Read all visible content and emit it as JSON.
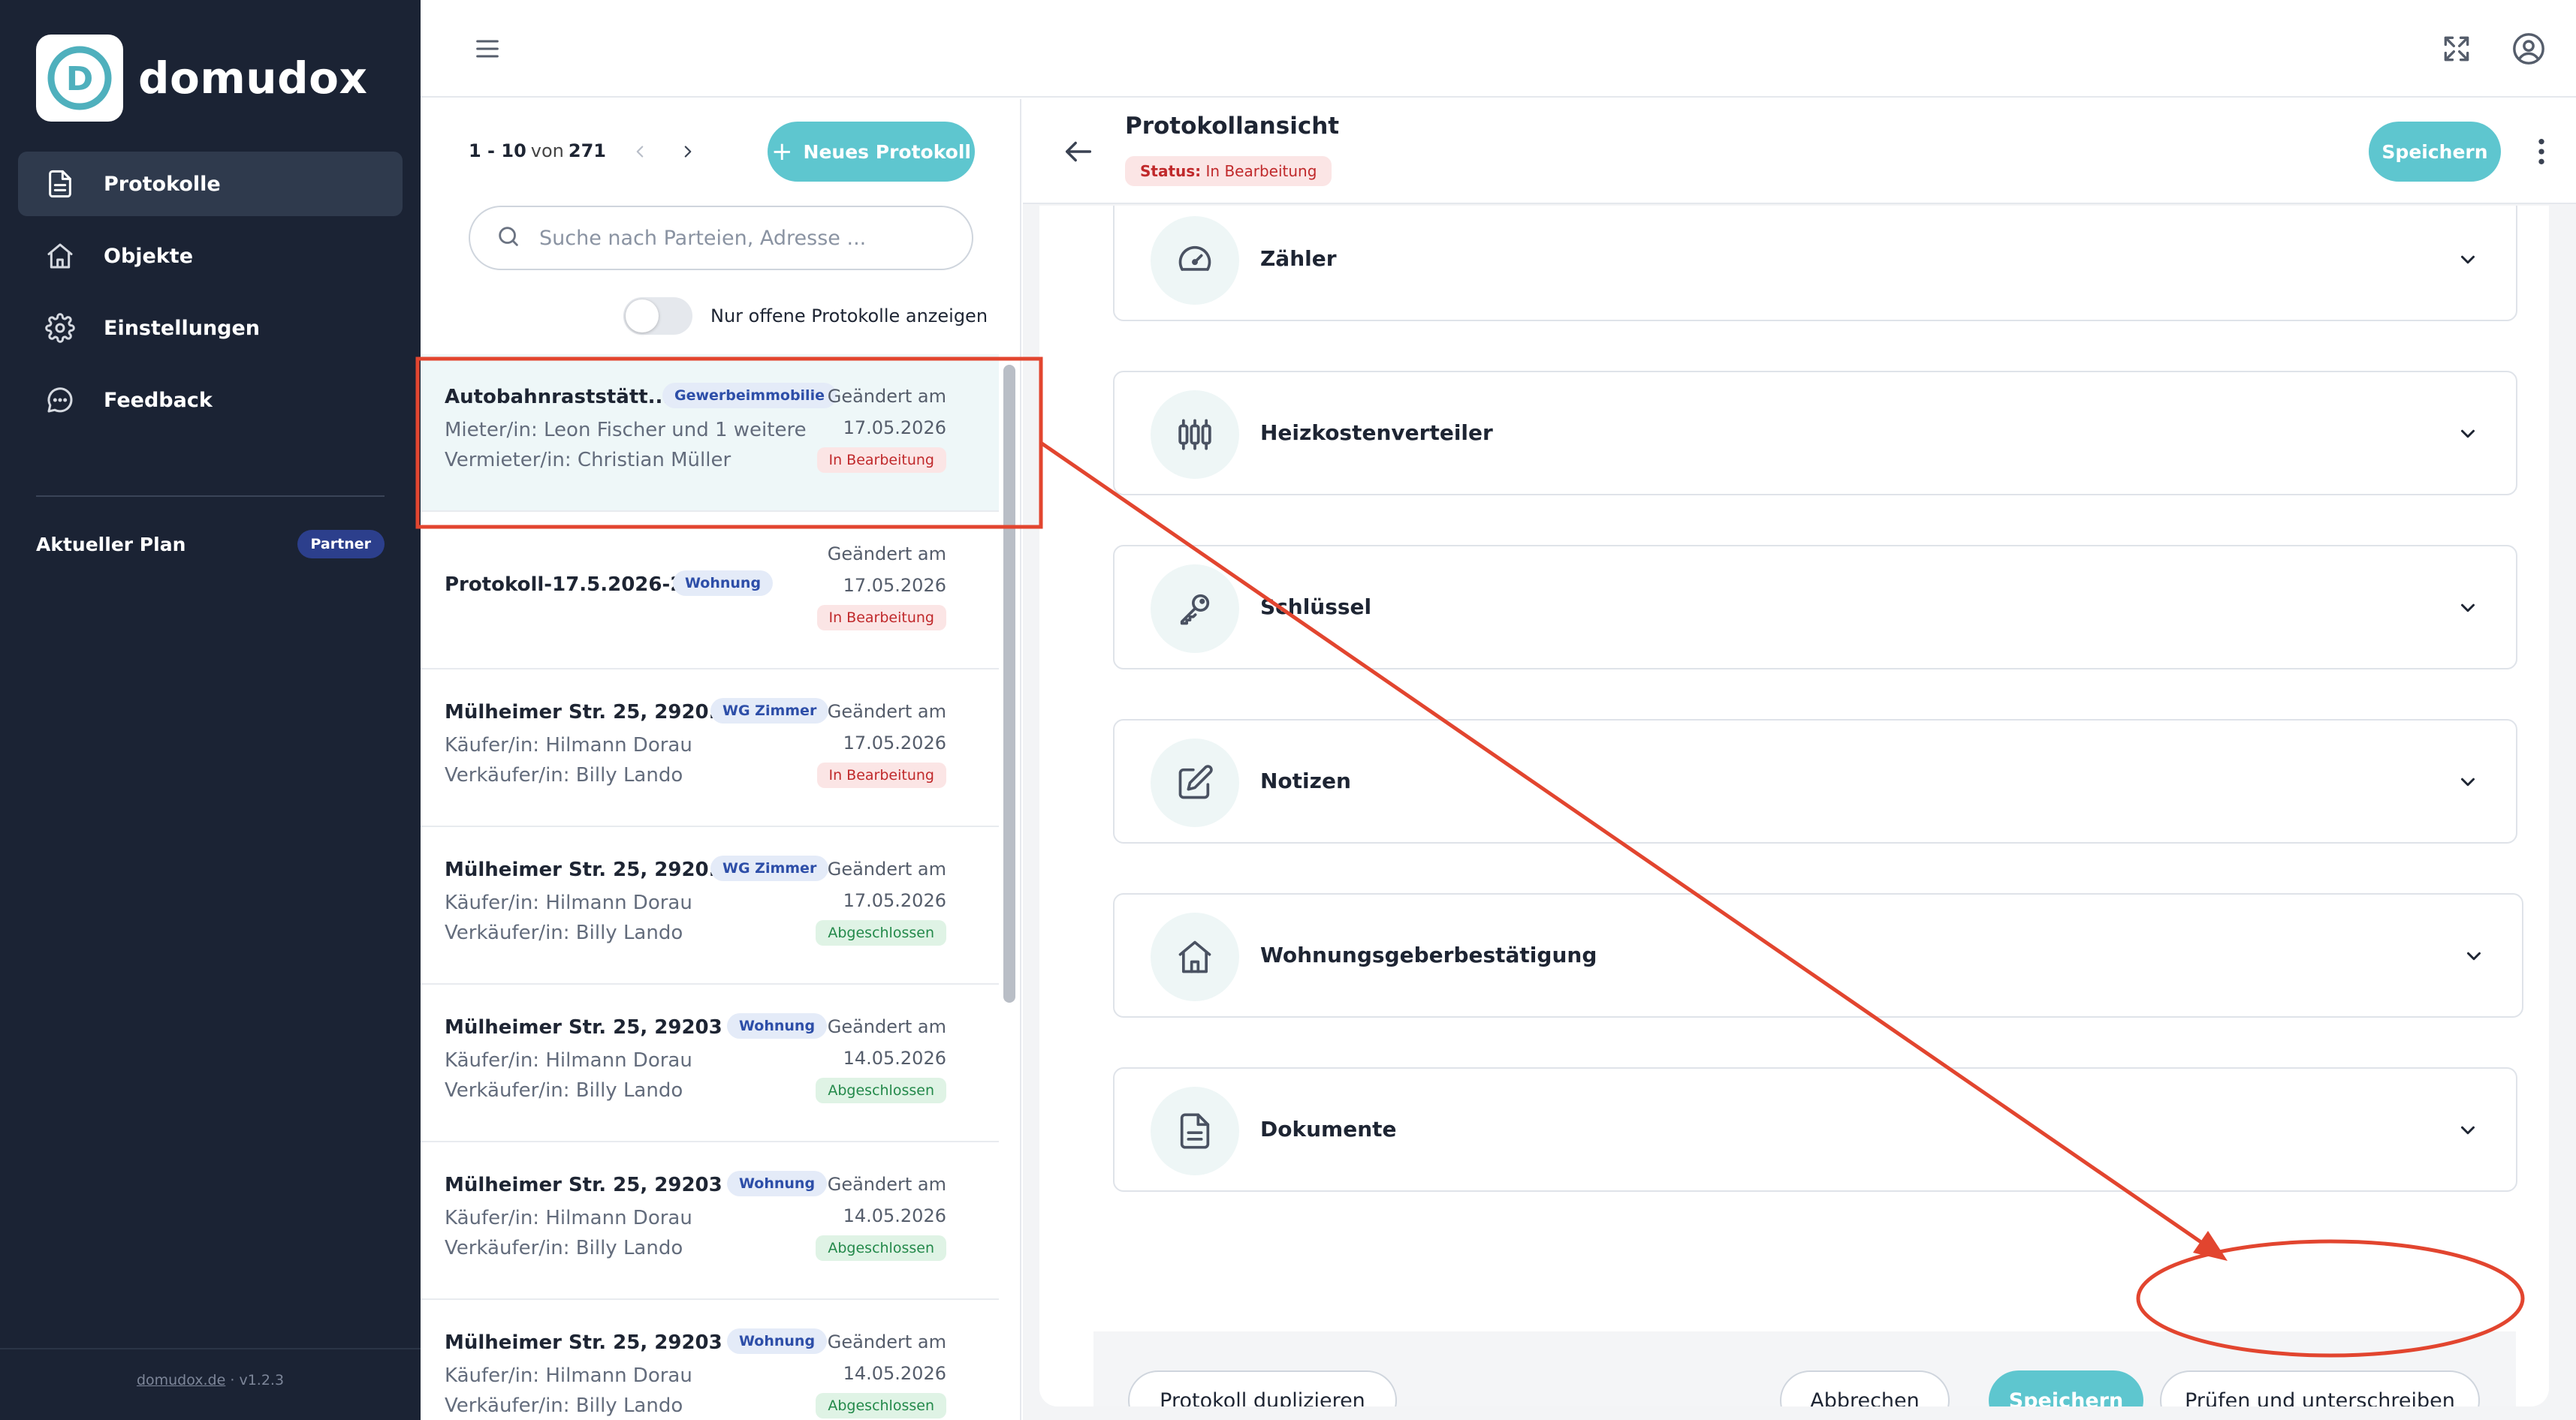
{
  "app": {
    "name": "domudox",
    "logo_letter": "D"
  },
  "sidebar": {
    "items": [
      {
        "label": "Protokolle",
        "icon": "document-icon",
        "active": true
      },
      {
        "label": "Objekte",
        "icon": "home-icon",
        "active": false
      },
      {
        "label": "Einstellungen",
        "icon": "gear-icon",
        "active": false
      },
      {
        "label": "Feedback",
        "icon": "chat-icon",
        "active": false
      }
    ],
    "plan_label": "Aktueller Plan",
    "plan_badge": "Partner",
    "footer_link": "domudox.de",
    "footer_sep": "·",
    "footer_version": "v1.2.3"
  },
  "list": {
    "pager": {
      "range": "1 - 10",
      "of": "von",
      "total": "271"
    },
    "new_button": "Neues Protokoll",
    "search_placeholder": "Suche nach Parteien, Adresse ...",
    "toggle_label": "Nur offene Protokolle anzeigen",
    "items": [
      {
        "title": "Autobahnraststätt...",
        "type": "Gewerbeimmobilie",
        "line1": "Mieter/in: Leon Fischer und 1 weitere",
        "line2": "Vermieter/in: Christian Müller",
        "changed": "Geändert am",
        "date": "17.05.2026",
        "status": "In Bearbeitung"
      },
      {
        "title": "Protokoll-17.5.2026-2",
        "type": "Wohnung",
        "line1": "",
        "line2": "",
        "changed": "Geändert am",
        "date": "17.05.2026",
        "status": "In Bearbeitung"
      },
      {
        "title": "Mülheimer Str. 25, 2920...",
        "type": "WG Zimmer",
        "line1": "Käufer/in: Hilmann Dorau",
        "line2": "Verkäufer/in: Billy Lando",
        "changed": "Geändert am",
        "date": "17.05.2026",
        "status": "In Bearbeitung"
      },
      {
        "title": "Mülheimer Str. 25, 2920...",
        "type": "WG Zimmer",
        "line1": "Käufer/in: Hilmann Dorau",
        "line2": "Verkäufer/in: Billy Lando",
        "changed": "Geändert am",
        "date": "17.05.2026",
        "status": "Abgeschlossen"
      },
      {
        "title": "Mülheimer Str. 25, 29203 ...",
        "type": "Wohnung",
        "line1": "Käufer/in: Hilmann Dorau",
        "line2": "Verkäufer/in: Billy Lando",
        "changed": "Geändert am",
        "date": "14.05.2026",
        "status": "Abgeschlossen"
      },
      {
        "title": "Mülheimer Str. 25, 29203 ...",
        "type": "Wohnung",
        "line1": "Käufer/in: Hilmann Dorau",
        "line2": "Verkäufer/in: Billy Lando",
        "changed": "Geändert am",
        "date": "14.05.2026",
        "status": "Abgeschlossen"
      },
      {
        "title": "Mülheimer Str. 25, 29203 ...",
        "type": "Wohnung",
        "line1": "Käufer/in: Hilmann Dorau",
        "line2": "Verkäufer/in: Billy Lando",
        "changed": "Geändert am",
        "date": "14.05.2026",
        "status": "Abgeschlossen"
      }
    ]
  },
  "detail": {
    "title": "Protokollansicht",
    "status_label": "Status:",
    "status_value": "In Bearbeitung",
    "save_top": "Speichern",
    "sections": [
      {
        "label": "Zähler",
        "icon": "gauge-icon"
      },
      {
        "label": "Heizkostenverteiler",
        "icon": "heating-meter-icon"
      },
      {
        "label": "Schlüssel",
        "icon": "key-icon"
      },
      {
        "label": "Notizen",
        "icon": "edit-note-icon"
      },
      {
        "label": "Wohnungsgeberbestätigung",
        "icon": "home-icon"
      },
      {
        "label": "Dokumente",
        "icon": "document-icon"
      }
    ],
    "footer": {
      "duplicate": "Protokoll duplizieren",
      "cancel": "Abbrechen",
      "save": "Speichern",
      "sign": "Prüfen und unterschreiben"
    }
  },
  "colors": {
    "sidebar_bg": "#1b2334",
    "accent": "#5ec6cf",
    "annotation": "#e2452f",
    "status_edit": "#c0292b",
    "status_done": "#23894a"
  }
}
